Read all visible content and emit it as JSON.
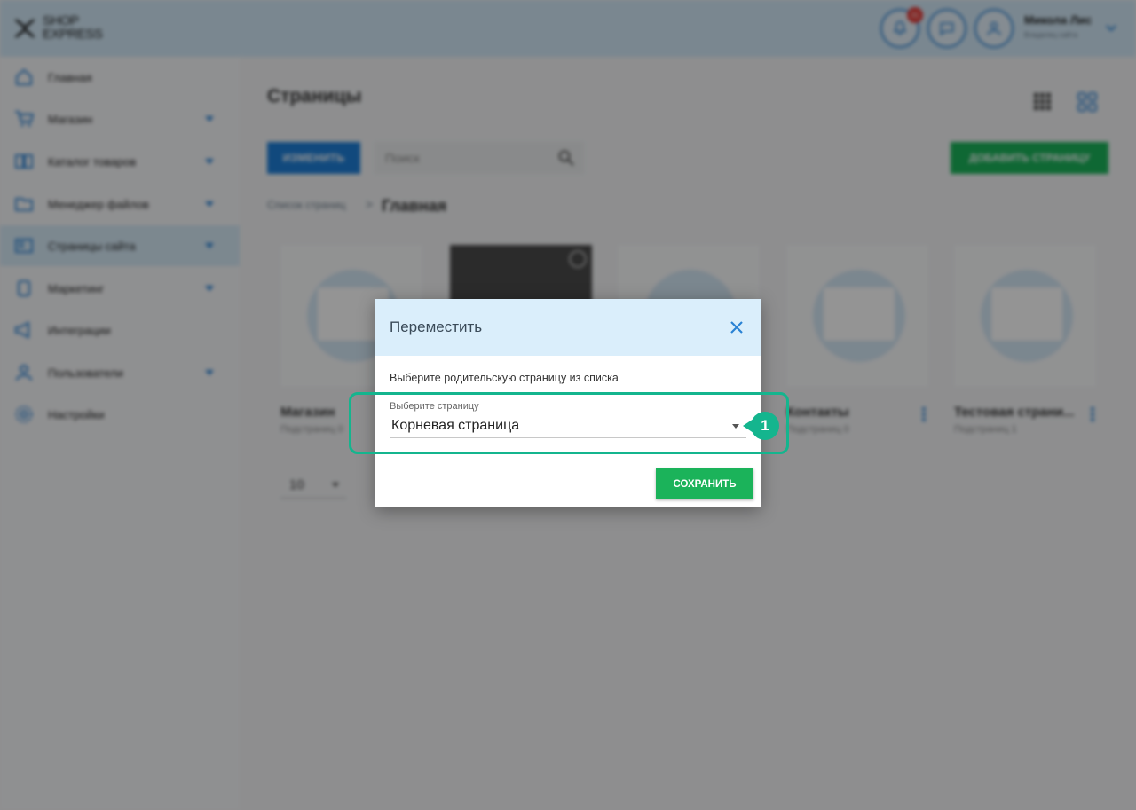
{
  "header": {
    "logo_line1": "SHOP",
    "logo_line2": "EXPRESS",
    "notifications_count": "31",
    "user_name": "Микола Лис",
    "user_role": "Владелец сайта"
  },
  "sidebar": {
    "items": [
      {
        "label": "Главная",
        "icon": "home-icon",
        "has_caret": false,
        "active": false
      },
      {
        "label": "Магазин",
        "icon": "cart-icon",
        "has_caret": true,
        "active": false
      },
      {
        "label": "Каталог товаров",
        "icon": "book-icon",
        "has_caret": true,
        "active": false
      },
      {
        "label": "Менеджер файлов",
        "icon": "folder-icon",
        "has_caret": true,
        "active": false
      },
      {
        "label": "Страницы сайта",
        "icon": "pages-icon",
        "has_caret": true,
        "active": true
      },
      {
        "label": "Маркетинг",
        "icon": "marketing-icon",
        "has_caret": true,
        "active": false
      },
      {
        "label": "Интеграции",
        "icon": "megaphone-icon",
        "has_caret": false,
        "active": false
      },
      {
        "label": "Пользователи",
        "icon": "user-icon",
        "has_caret": true,
        "active": false
      },
      {
        "label": "Настройки",
        "icon": "gear-icon",
        "has_caret": false,
        "active": false
      }
    ]
  },
  "main": {
    "title": "Страницы",
    "edit_button": "ИЗМЕНИТЬ",
    "search_placeholder": "Поиск",
    "add_button": "ДОБАВИТЬ СТРАНИЦУ",
    "breadcrumb_link": "Список страниц",
    "breadcrumb_sep": ">",
    "breadcrumb_current": "Главная",
    "per_page": "10",
    "cards": [
      {
        "title": "Магазин",
        "subtitle": "Подстраниц 0"
      },
      {
        "title": "",
        "subtitle": ""
      },
      {
        "title": "",
        "subtitle": ""
      },
      {
        "title": "Контакты",
        "subtitle": "Подстраниц 0"
      },
      {
        "title": "Тестовая страни...",
        "subtitle": "Подстраниц 1"
      }
    ]
  },
  "modal": {
    "title": "Переместить",
    "hint": "Выберите родительскую страницу из списка",
    "select_label": "Выберите страницу",
    "select_value": "Корневая страница",
    "save_button": "СОХРАНИТЬ"
  },
  "callout": {
    "step_number": "1"
  },
  "colors": {
    "accent_blue": "#1e7fd8",
    "accent_green": "#1bb35a",
    "callout_teal": "#14b58e",
    "modal_header": "#daeefb"
  }
}
